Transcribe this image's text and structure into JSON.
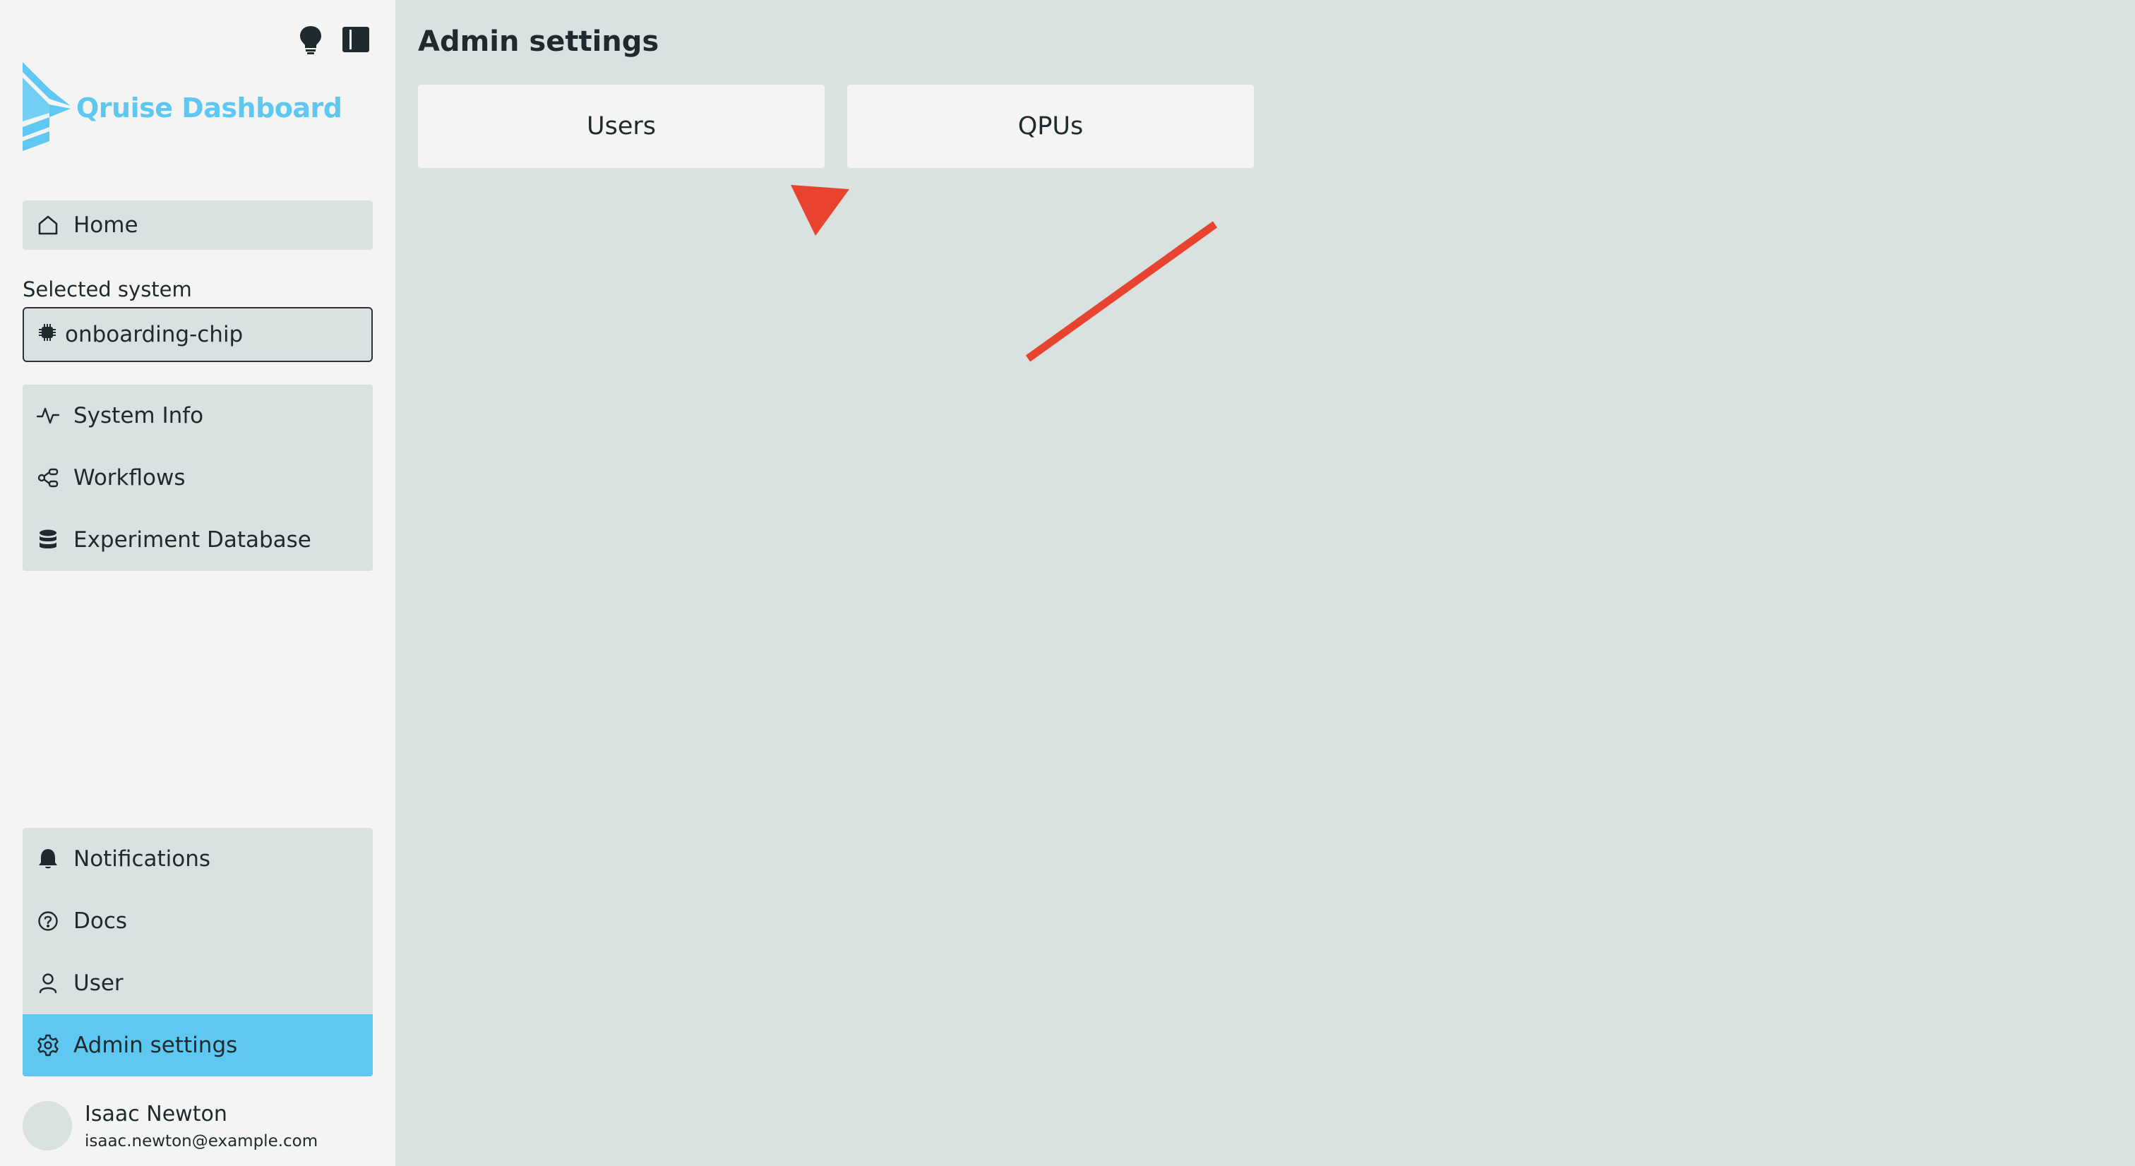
{
  "app": {
    "name": "Qruise Dashboard"
  },
  "top_icons": [
    "lightbulb-icon",
    "sidebar-toggle-icon"
  ],
  "nav": {
    "home": {
      "label": "Home",
      "icon": "home-icon"
    },
    "selected_system_label": "Selected system",
    "selected_system_value": "onboarding-chip",
    "system_items": [
      {
        "label": "System Info",
        "icon": "activity-icon"
      },
      {
        "label": "Workflows",
        "icon": "workflow-icon"
      },
      {
        "label": "Experiment Database",
        "icon": "database-icon"
      }
    ],
    "bottom_items": [
      {
        "label": "Notifications",
        "icon": "bell-icon"
      },
      {
        "label": "Docs",
        "icon": "help-circle-icon"
      },
      {
        "label": "User",
        "icon": "user-icon"
      },
      {
        "label": "Admin settings",
        "icon": "gear-icon",
        "active": true
      }
    ]
  },
  "user": {
    "name": "Isaac Newton",
    "email": "isaac.newton@example.com"
  },
  "main": {
    "title": "Admin settings",
    "cards": [
      {
        "label": "Users"
      },
      {
        "label": "QPUs"
      }
    ]
  },
  "colors": {
    "accent": "#5ec8f2",
    "sidebar_bg": "#f4f5f2",
    "main_bg": "#d9e1e1",
    "annotation_arrow": "#e8432e"
  }
}
